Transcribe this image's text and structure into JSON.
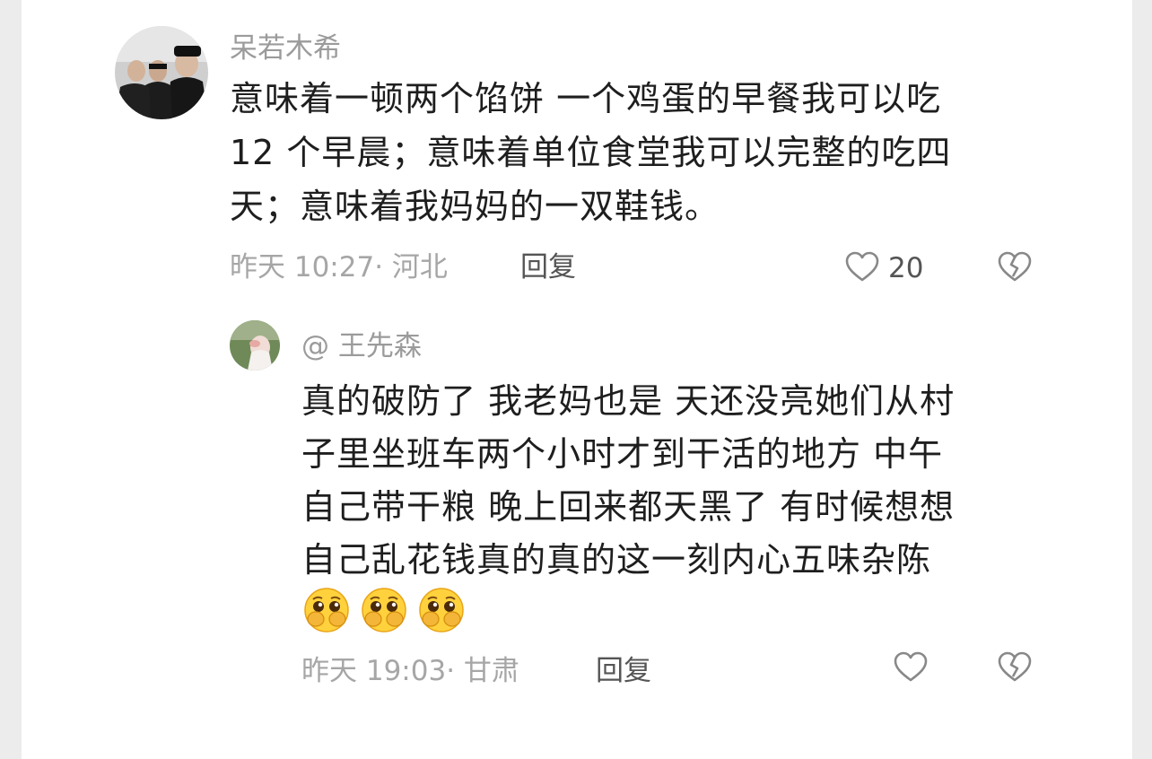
{
  "comment": {
    "username": "呆若木希",
    "lines": [
      "意味着一顿两个馅饼 一个鸡蛋的早餐我可以吃",
      "12 个早晨；意味着单位食堂我可以完整的吃四",
      "天；意味着我妈妈的一双鞋钱。"
    ],
    "time": "昨天 10:27· 河北",
    "reply_label": "回复",
    "like_count": "20",
    "like_icon": "heart-outline-icon",
    "dislike_icon": "broken-heart-icon"
  },
  "reply": {
    "username": "@ 王先森",
    "lines": [
      "真的破防了  我老妈也是 天还没亮她们从村",
      "子里坐班车两个小时才到干活的地方  中午",
      "自己带干粮 晚上回来都天黑了 有时候想想",
      "自己乱花钱真的真的这一刻内心五味杂陈"
    ],
    "emoji_icons": [
      "pleading-face-emoji",
      "pleading-face-emoji",
      "pleading-face-emoji"
    ],
    "time": "昨天 19:03· 甘肃",
    "reply_label": "回复",
    "like_icon": "heart-outline-icon",
    "dislike_icon": "broken-heart-icon"
  },
  "colors": {
    "background": "#ececec",
    "card": "#ffffff",
    "text": "#1e1e1e",
    "muted": "#a6a6a6"
  }
}
